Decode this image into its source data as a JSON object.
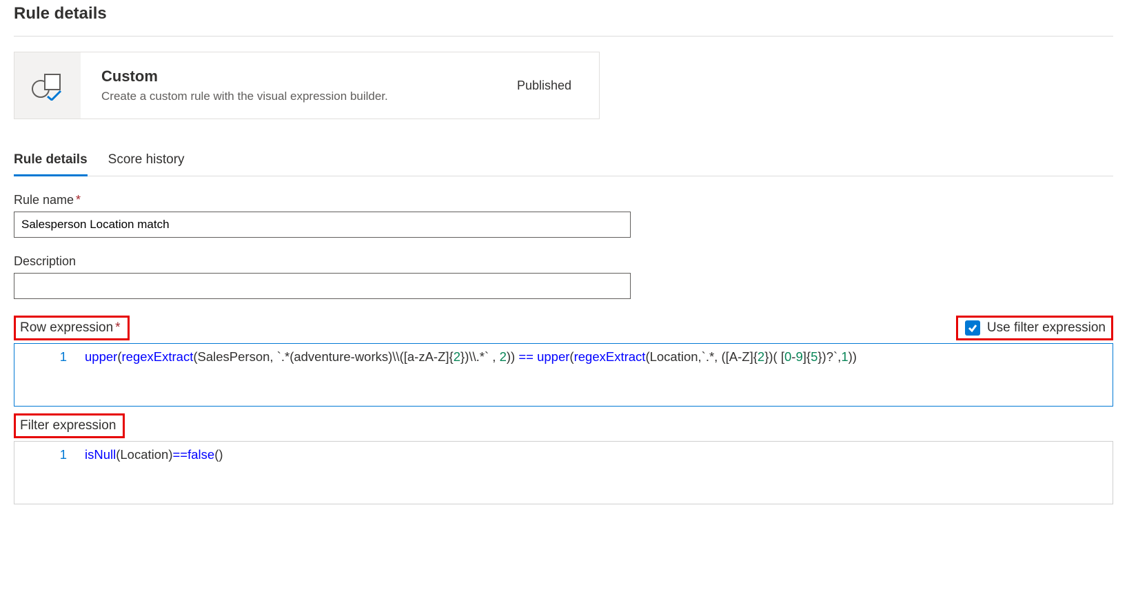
{
  "page": {
    "title": "Rule details"
  },
  "card": {
    "title": "Custom",
    "description": "Create a custom rule with the visual expression builder.",
    "status": "Published"
  },
  "tabs": [
    {
      "id": "rule-details",
      "label": "Rule details",
      "active": true
    },
    {
      "id": "score-history",
      "label": "Score history",
      "active": false
    }
  ],
  "form": {
    "rule_name_label": "Rule name",
    "rule_name_value": "Salesperson Location match",
    "description_label": "Description",
    "description_value": "",
    "row_expression_label": "Row expression",
    "use_filter_checkbox_label": "Use filter expression",
    "use_filter_checked": true,
    "filter_expression_label": "Filter expression"
  },
  "editors": {
    "row_line_no": "1",
    "filter_line_no": "1",
    "row_tokens": {
      "upper1": "upper",
      "p1": "(",
      "regex1": "regexExtract",
      "p2": "(SalesPerson, `.*(adventure",
      "dash1": "-",
      "after_dash1": "works)\\\\([a",
      "dash2": "-",
      "mid1": "zA",
      "dash3": "-",
      "mid2": "Z]{",
      "two1": "2",
      "mid3": "})\\\\.*` , ",
      "two2": "2",
      "mid4": ")) ",
      "eq": "==",
      "sp": " ",
      "upper2": "upper",
      "p3": "(",
      "regex2": "regexExtract",
      "p4": "(Location,`.*, ([A",
      "dash4": "-",
      "mid5": "Z]{",
      "two3": "2",
      "mid6": "})( [",
      "zero": "0",
      "dash5": "-",
      "nine": "9",
      "mid7": "]{",
      "five": "5",
      "mid8": "})?`,",
      "one": "1",
      "end": "))"
    },
    "filter_tokens": {
      "isnull": "isNull",
      "p1": "(Location)",
      "eq": "==",
      "false": "false",
      "p2": "()"
    }
  }
}
